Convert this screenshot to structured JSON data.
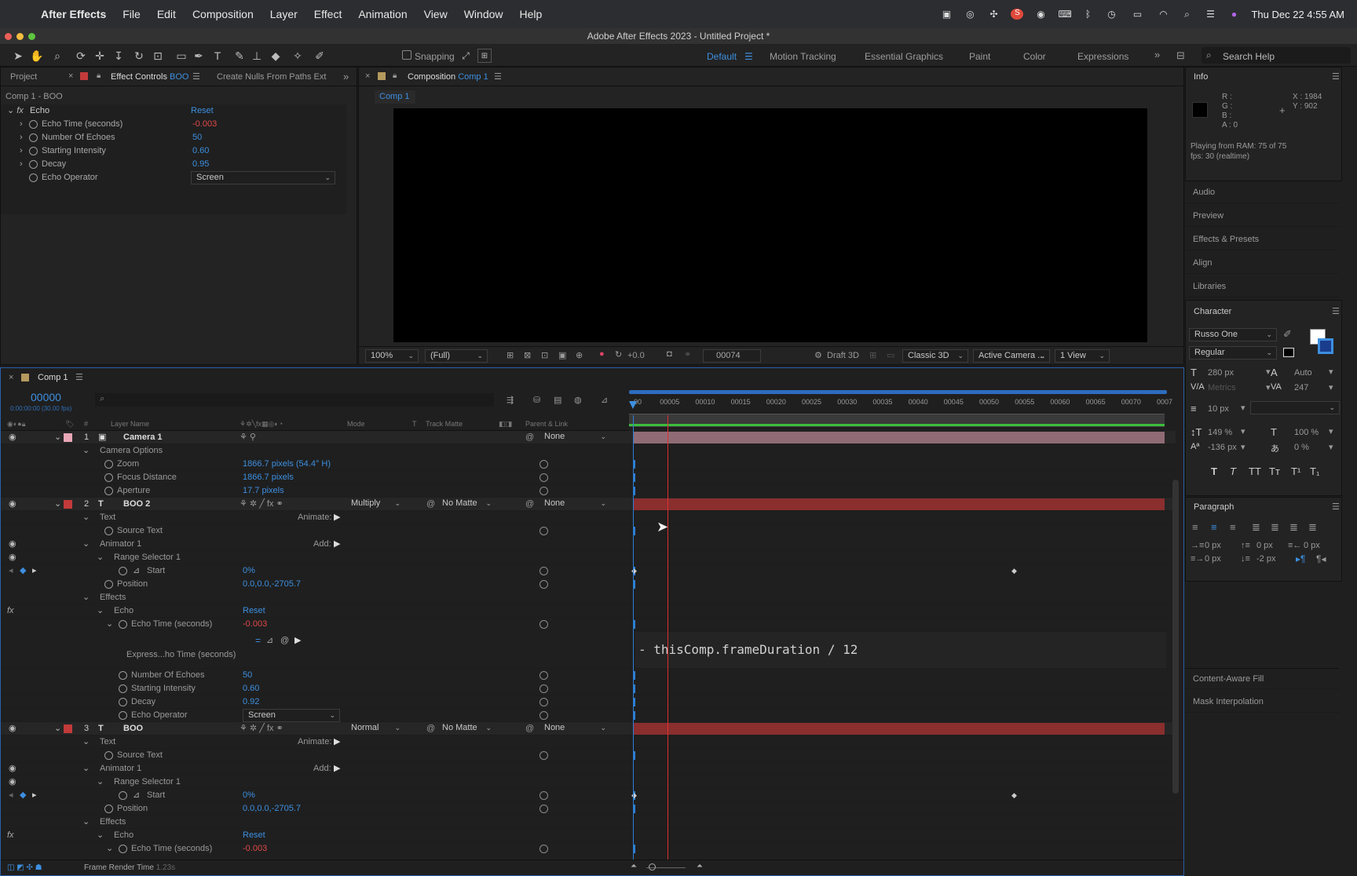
{
  "menubar": {
    "items": [
      "After Effects",
      "File",
      "Edit",
      "Composition",
      "Layer",
      "Effect",
      "Animation",
      "View",
      "Window",
      "Help"
    ],
    "clock": "Thu Dec 22  4:55 AM"
  },
  "title": "Adobe After Effects 2023 - Untitled Project *",
  "toolbar": {
    "snapping": "Snapping",
    "workspaces": [
      "Default",
      "Motion Tracking",
      "Essential Graphics",
      "Paint",
      "Color",
      "Expressions"
    ],
    "search_placeholder": "Search Help"
  },
  "effect_controls": {
    "tabs": {
      "project": "Project",
      "effect_controls": "Effect Controls",
      "layer": "BOO",
      "nulls": "Create Nulls From Paths Ext"
    },
    "breadcrumb": "Comp 1 - BOO",
    "effect": "Echo",
    "reset": "Reset",
    "props": [
      {
        "name": "Echo Time (seconds)",
        "value": "-0.003"
      },
      {
        "name": "Number Of Echoes",
        "value": "50"
      },
      {
        "name": "Starting Intensity",
        "value": "0.60"
      },
      {
        "name": "Decay",
        "value": "0.95"
      },
      {
        "name": "Echo Operator",
        "value": "Screen"
      }
    ]
  },
  "composition": {
    "tab": "Composition",
    "comp": "Comp 1",
    "subtab": "Comp 1",
    "zoom": "100%",
    "resolution": "(Full)",
    "exposure": "+0.0",
    "frame": "00074",
    "draft": "Draft 3D",
    "renderer": "Classic 3D",
    "camera": "Active Camera ...",
    "views": "1 View"
  },
  "info": {
    "title": "Info",
    "r": "R :",
    "g": "G :",
    "b": "B :",
    "a": "A :  0",
    "x": "X : 1984",
    "y": "Y : 902",
    "ram": "Playing from RAM: 75 of 75",
    "fps": "fps: 30 (realtime)"
  },
  "right_panels": [
    "Audio",
    "Preview",
    "Effects & Presets",
    "Align",
    "Libraries"
  ],
  "character": {
    "title": "Character",
    "font": "Russo One",
    "style": "Regular",
    "size": "280 px",
    "leading": "Auto",
    "kerning": "Metrics",
    "tracking": "247",
    "stroke": "10 px",
    "vscale": "149 %",
    "hscale": "100 %",
    "baseline": "-136 px",
    "tsume": "0 %",
    "styles": [
      "T",
      "T",
      "TT",
      "Tт",
      "T¹",
      "T₁"
    ]
  },
  "paragraph": {
    "title": "Paragraph",
    "indent_left": "0 px",
    "indent_first": "0 px",
    "indent_right": "0 px",
    "space_before": "0 px",
    "space_after": "-2 px"
  },
  "right_panels_bottom": [
    "Content-Aware Fill",
    "Mask Interpolation"
  ],
  "timeline": {
    "tab": "Comp 1",
    "timecode": "00000",
    "timecode_sub": "0:00:00:00 (30.00 fps)",
    "headers": {
      "num": "#",
      "name": "Layer Name",
      "mode": "Mode",
      "t": "T",
      "matte": "Track Matte",
      "parent": "Parent & Link"
    },
    "ruler": [
      "00",
      "00005",
      "00010",
      "00015",
      "00020",
      "00025",
      "00030",
      "00035",
      "00040",
      "00045",
      "00050",
      "00055",
      "00060",
      "00065",
      "00070",
      "0007"
    ],
    "rows": [
      {
        "kind": "layer",
        "num": "1",
        "name": "Camera 1",
        "color": "#e8a6b6",
        "icon": "cam",
        "parent": "None"
      },
      {
        "kind": "group",
        "indent": 1,
        "name": "Camera Options"
      },
      {
        "kind": "prop",
        "indent": 2,
        "name": "Zoom",
        "value": "1866.7 pixels (54.4° H)"
      },
      {
        "kind": "prop",
        "indent": 2,
        "name": "Focus Distance",
        "value": "1866.7 pixels"
      },
      {
        "kind": "prop",
        "indent": 2,
        "name": "Aperture",
        "value": "17.7 pixels"
      },
      {
        "kind": "layer",
        "num": "2",
        "name": "BOO 2",
        "color": "#c23a3a",
        "icon": "T",
        "mode": "Multiply",
        "matte": "No Matte",
        "parent": "None"
      },
      {
        "kind": "group",
        "indent": 1,
        "name": "Text",
        "right": "Animate:"
      },
      {
        "kind": "prop",
        "indent": 2,
        "name": "Source Text"
      },
      {
        "kind": "group",
        "indent": 1,
        "name": "Animator 1",
        "right": "Add:",
        "eye": true
      },
      {
        "kind": "group",
        "indent": 2,
        "name": "Range Selector 1",
        "eye": true
      },
      {
        "kind": "prop",
        "indent": 3,
        "name": "Start",
        "value": "0%",
        "kf": true
      },
      {
        "kind": "prop",
        "indent": 2,
        "name": "Position",
        "value": "0.0,0.0,-2705.7"
      },
      {
        "kind": "group",
        "indent": 1,
        "name": "Effects"
      },
      {
        "kind": "group",
        "indent": 2,
        "name": "Echo",
        "value": "Reset",
        "fx": true
      },
      {
        "kind": "prop",
        "indent": 3,
        "name": "Echo Time (seconds)",
        "value": "-0.003",
        "red": true,
        "open": true
      },
      {
        "kind": "expr",
        "name": "Express...ho Time (seconds)",
        "code": "- thisComp.frameDuration / 12"
      },
      {
        "kind": "prop",
        "indent": 3,
        "name": "Number Of Echoes",
        "value": "50"
      },
      {
        "kind": "prop",
        "indent": 3,
        "name": "Starting Intensity",
        "value": "0.60"
      },
      {
        "kind": "prop",
        "indent": 3,
        "name": "Decay",
        "value": "0.92"
      },
      {
        "kind": "prop",
        "indent": 3,
        "name": "Echo Operator",
        "value": "Screen",
        "dd": true
      },
      {
        "kind": "layer",
        "num": "3",
        "name": "BOO",
        "color": "#c23a3a",
        "icon": "T",
        "mode": "Normal",
        "matte": "No Matte",
        "parent": "None"
      },
      {
        "kind": "group",
        "indent": 1,
        "name": "Text",
        "right": "Animate:"
      },
      {
        "kind": "prop",
        "indent": 2,
        "name": "Source Text"
      },
      {
        "kind": "group",
        "indent": 1,
        "name": "Animator 1",
        "right": "Add:",
        "eye": true
      },
      {
        "kind": "group",
        "indent": 2,
        "name": "Range Selector 1",
        "eye": true
      },
      {
        "kind": "prop",
        "indent": 3,
        "name": "Start",
        "value": "0%",
        "kf": true
      },
      {
        "kind": "prop",
        "indent": 2,
        "name": "Position",
        "value": "0.0,0.0,-2705.7"
      },
      {
        "kind": "group",
        "indent": 1,
        "name": "Effects"
      },
      {
        "kind": "group",
        "indent": 2,
        "name": "Echo",
        "value": "Reset",
        "fx": true
      },
      {
        "kind": "prop",
        "indent": 3,
        "name": "Echo Time (seconds)",
        "value": "-0.003",
        "red": true,
        "open": true
      }
    ],
    "footer": "Frame Render Time",
    "footer_time": "1.23s"
  }
}
